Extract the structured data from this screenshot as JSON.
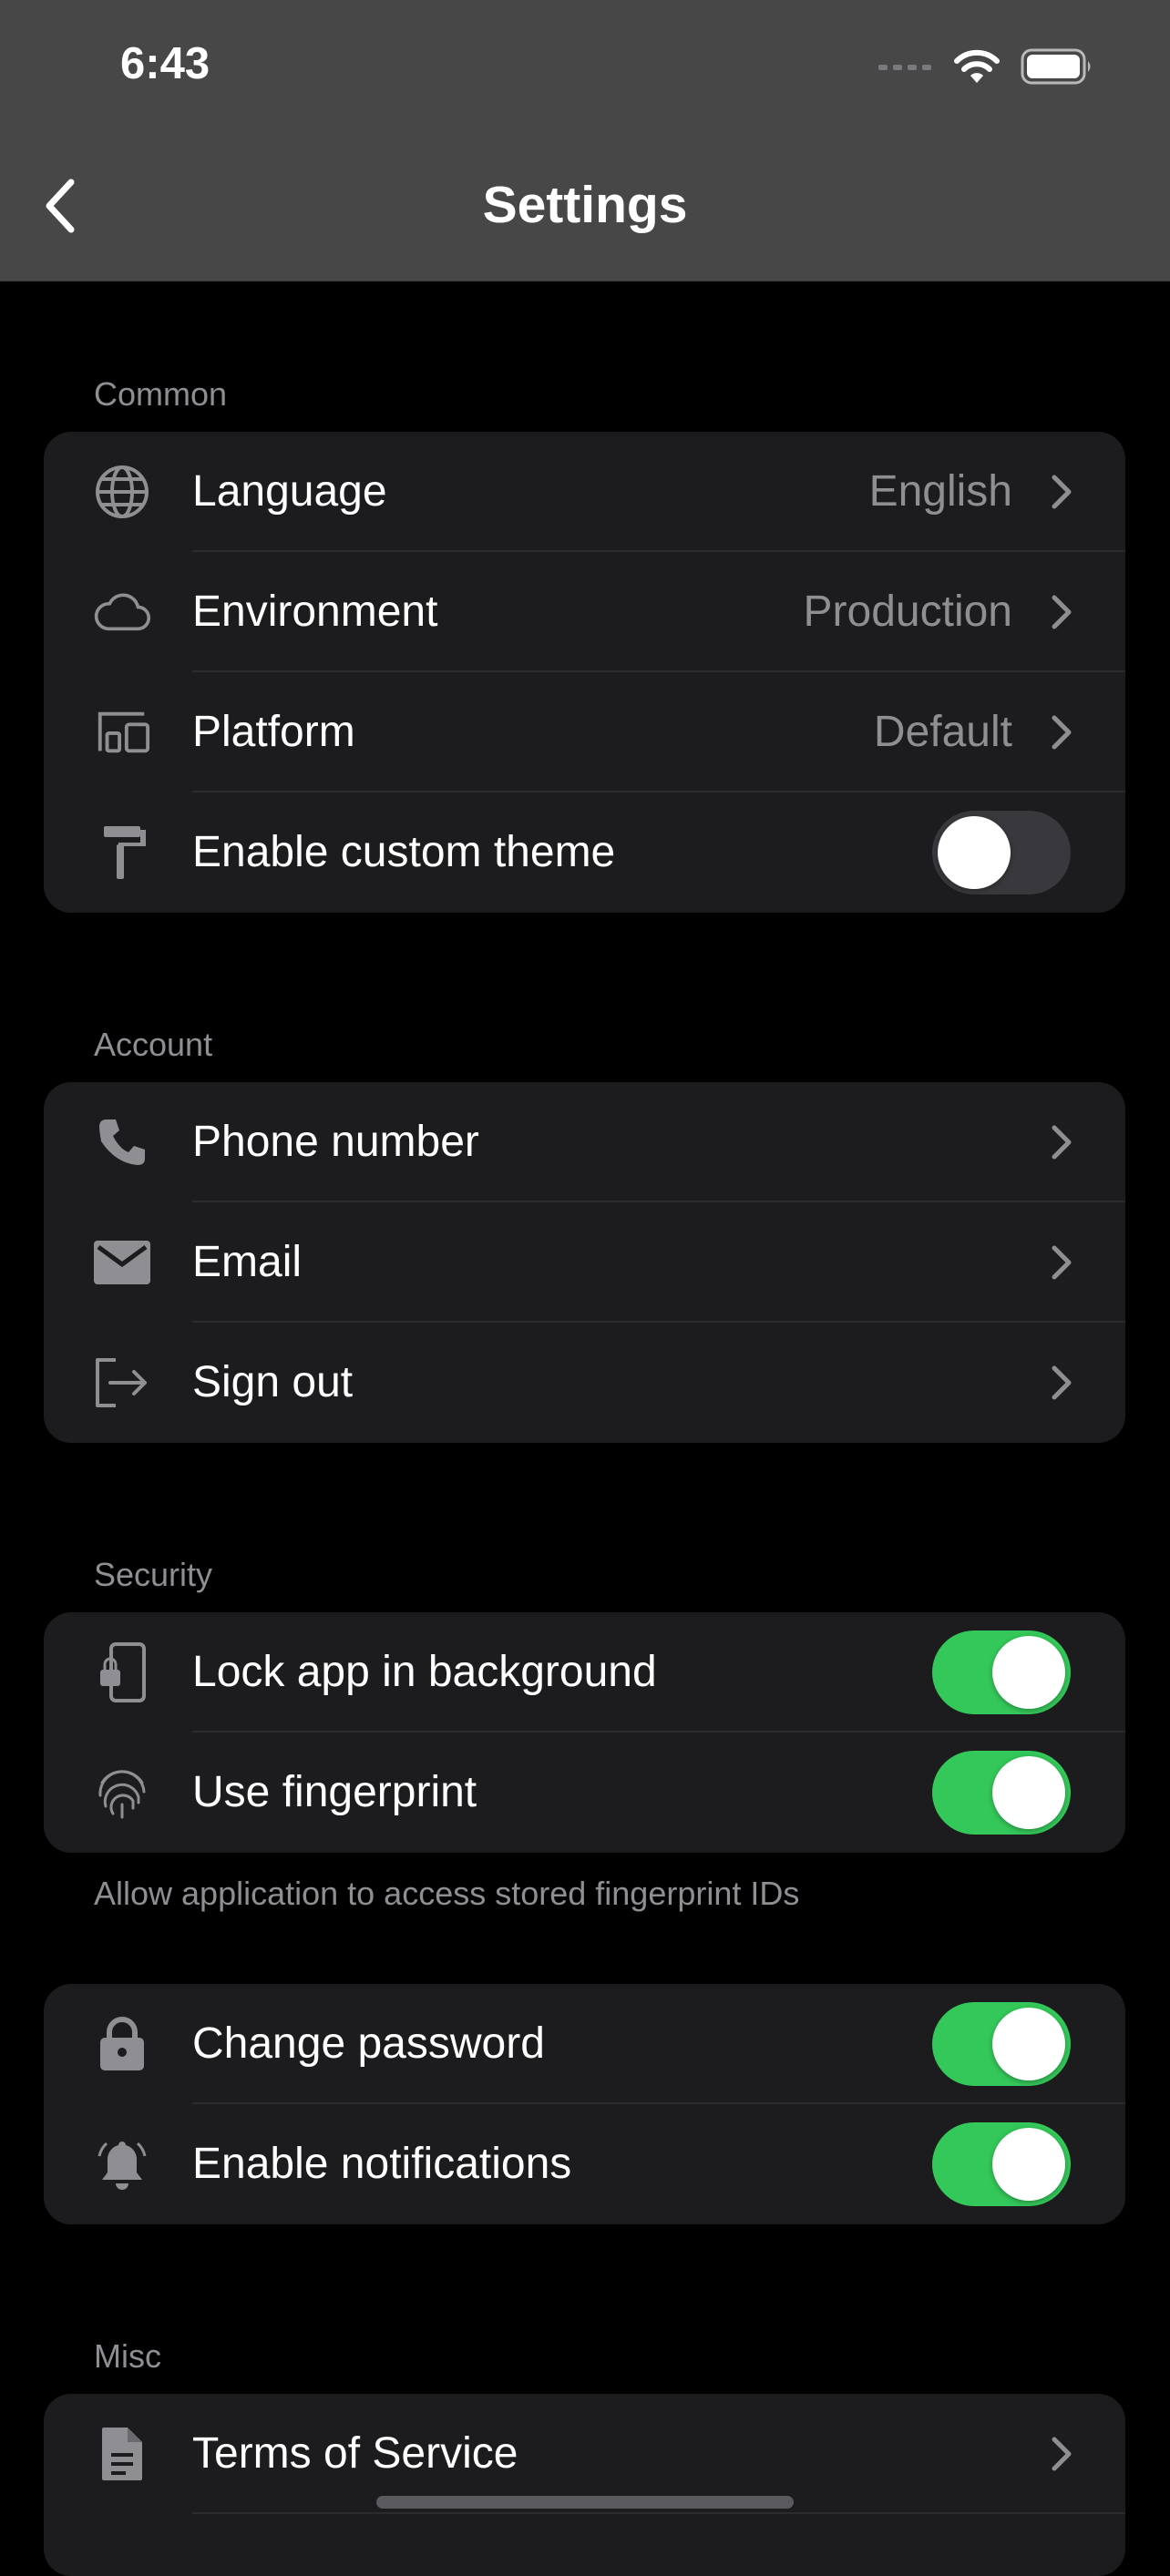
{
  "status_bar": {
    "time": "6:43"
  },
  "nav": {
    "title": "Settings"
  },
  "sections": {
    "common": {
      "header": "Common",
      "language": {
        "label": "Language",
        "value": "English"
      },
      "environment": {
        "label": "Environment",
        "value": "Production"
      },
      "platform": {
        "label": "Platform",
        "value": "Default"
      },
      "custom_theme": {
        "label": "Enable custom theme",
        "enabled": false
      }
    },
    "account": {
      "header": "Account",
      "phone": {
        "label": "Phone number"
      },
      "email": {
        "label": "Email"
      },
      "sign_out": {
        "label": "Sign out"
      }
    },
    "security": {
      "header": "Security",
      "lock_app": {
        "label": "Lock app in background",
        "enabled": true
      },
      "fingerprint": {
        "label": "Use fingerprint",
        "enabled": true
      },
      "footer": "Allow application to access stored fingerprint IDs"
    },
    "security2": {
      "change_password": {
        "label": "Change password",
        "enabled": true
      },
      "notifications": {
        "label": "Enable notifications",
        "enabled": true
      }
    },
    "misc": {
      "header": "Misc",
      "terms": {
        "label": "Terms of Service"
      }
    }
  },
  "colors": {
    "toggle_on": "#34c759",
    "toggle_off": "#39393d",
    "group_bg": "#1c1c1e",
    "secondary_text": "#8e8e93"
  },
  "icons": [
    "back-chevron-icon",
    "globe-icon",
    "cloud-icon",
    "devices-icon",
    "paint-roller-icon",
    "phone-icon",
    "mail-icon",
    "sign-out-icon",
    "phone-lock-icon",
    "fingerprint-icon",
    "lock-icon",
    "bell-icon",
    "document-icon",
    "chevron-right-icon"
  ]
}
